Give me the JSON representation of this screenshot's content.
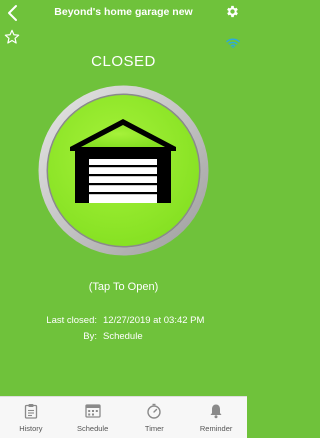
{
  "header": {
    "title": "Beyond's home garage new",
    "back_icon": "chevron-left-icon",
    "settings_icon": "gear-icon"
  },
  "favorite_icon": "star-outline-icon",
  "wifi_icon": "wifi-icon",
  "door": {
    "status": "CLOSED",
    "tap_hint": "(Tap To Open)",
    "icon": "garage-door-icon"
  },
  "info": {
    "last_closed_label": "Last closed:",
    "last_closed_value": "12/27/2019 at 03:42 PM",
    "by_label": "By:",
    "by_value": "Schedule"
  },
  "tabs": [
    {
      "label": "History",
      "icon": "clipboard-icon"
    },
    {
      "label": "Schedule",
      "icon": "calendar-icon"
    },
    {
      "label": "Timer",
      "icon": "timer-icon"
    },
    {
      "label": "Reminder",
      "icon": "bell-icon"
    }
  ],
  "colors": {
    "background": "#6fc23b",
    "button_green": "#8ee82c",
    "ring_silver": "#c8c8c8",
    "wifi": "#2aa8e0",
    "tabbar": "#f7f7f7"
  }
}
